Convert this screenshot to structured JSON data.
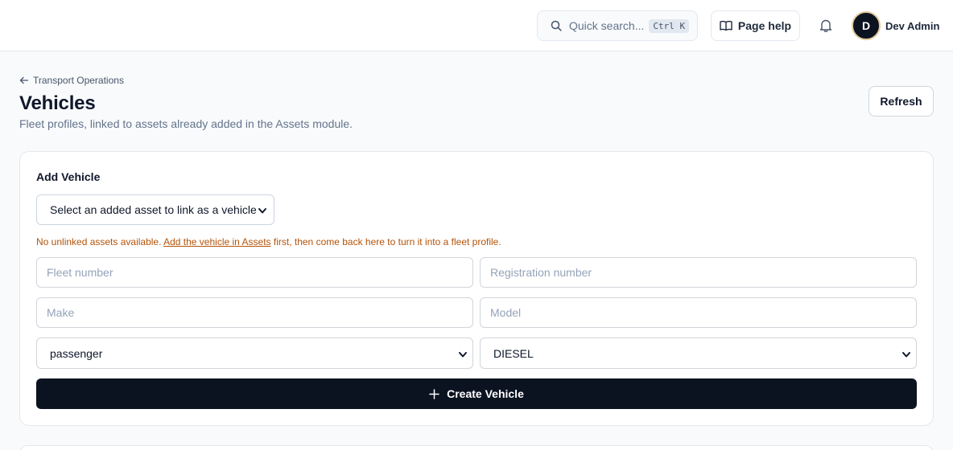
{
  "header": {
    "search_placeholder": "Quick search...",
    "search_shortcut": "Ctrl K",
    "help_label": "Page help",
    "user_initial": "D",
    "user_name": "Dev Admin"
  },
  "page": {
    "breadcrumb": "Transport Operations",
    "title": "Vehicles",
    "subtitle": "Fleet profiles, linked to assets already added in the Assets module.",
    "refresh_label": "Refresh"
  },
  "form": {
    "card_title": "Add Vehicle",
    "asset_select_value": "Select an added asset to link as a vehicle",
    "notice_prefix": "No unlinked assets available.",
    "notice_link": "Add the vehicle in Assets",
    "notice_suffix": "first, then come back here to turn it into a fleet profile.",
    "fleet_number_placeholder": "Fleet number",
    "registration_placeholder": "Registration number",
    "make_placeholder": "Make",
    "model_placeholder": "Model",
    "vehicle_type_value": "passenger",
    "fuel_type_value": "DIESEL",
    "create_label": "Create Vehicle"
  },
  "colors": {
    "primary_button": "#0b1220",
    "warning_text": "#b45309",
    "avatar_ring": "#e2c99a"
  },
  "icons": [
    "search-icon",
    "book-icon",
    "bell-icon",
    "arrow-left-icon",
    "chevron-down-icon",
    "plus-icon"
  ]
}
